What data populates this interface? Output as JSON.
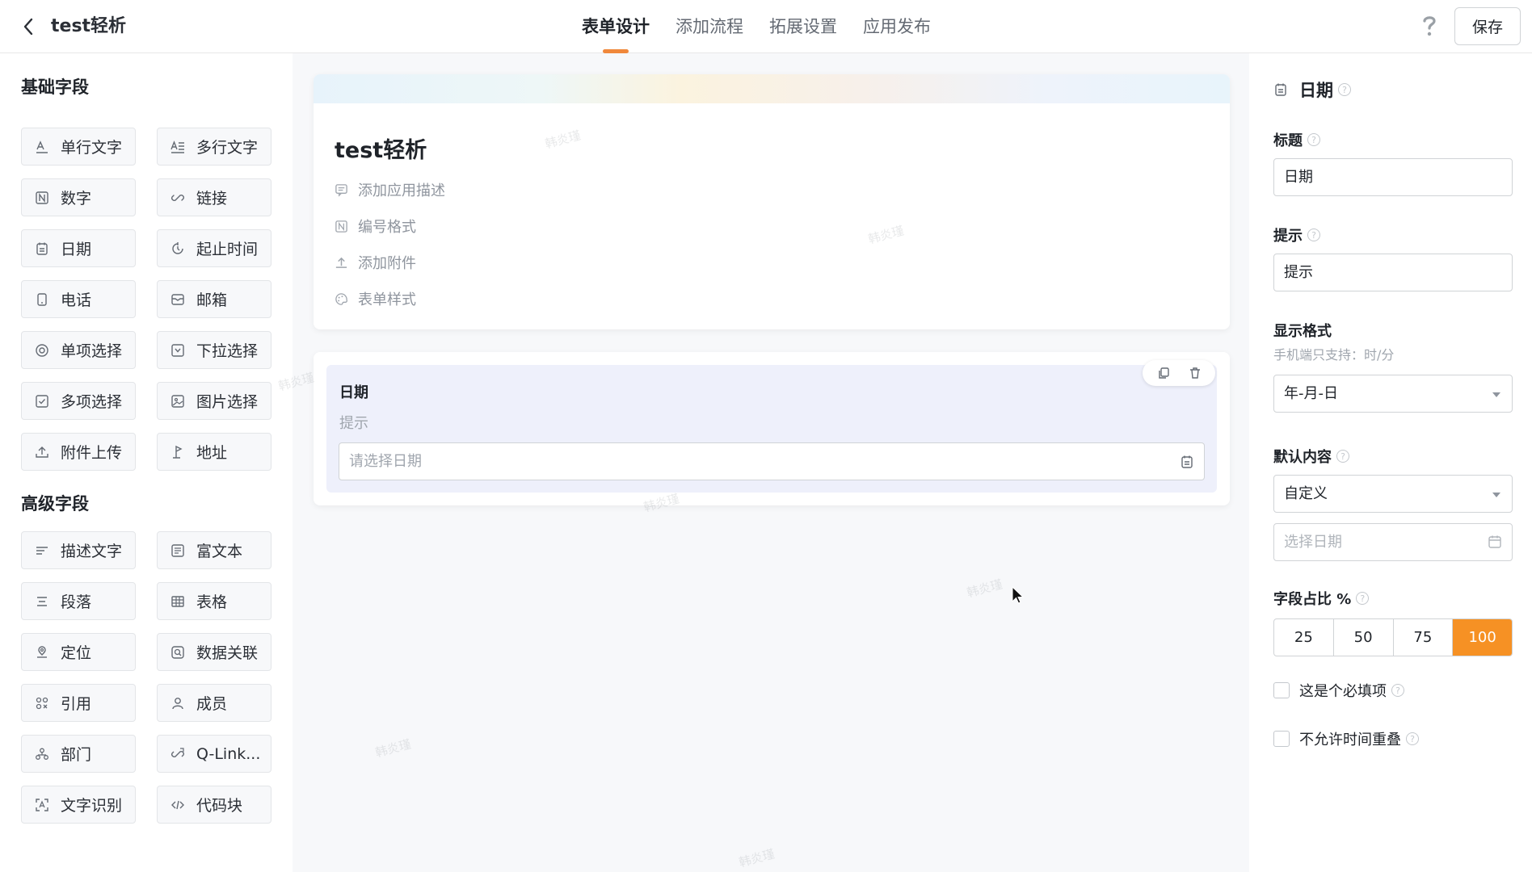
{
  "header": {
    "app_title": "test轻析",
    "tabs": [
      {
        "label": "表单设计",
        "active": true
      },
      {
        "label": "添加流程",
        "active": false
      },
      {
        "label": "拓展设置",
        "active": false
      },
      {
        "label": "应用发布",
        "active": false
      }
    ],
    "help_icon": "question-mark",
    "save_label": "保存"
  },
  "palette": {
    "basic_title": "基础字段",
    "basic_fields": [
      {
        "label": "单行文字",
        "icon": "single-text"
      },
      {
        "label": "多行文字",
        "icon": "multi-text"
      },
      {
        "label": "数字",
        "icon": "number"
      },
      {
        "label": "链接",
        "icon": "link"
      },
      {
        "label": "日期",
        "icon": "calendar"
      },
      {
        "label": "起止时间",
        "icon": "time-range"
      },
      {
        "label": "电话",
        "icon": "phone"
      },
      {
        "label": "邮箱",
        "icon": "mail"
      },
      {
        "label": "单项选择",
        "icon": "radio"
      },
      {
        "label": "下拉选择",
        "icon": "dropdown"
      },
      {
        "label": "多项选择",
        "icon": "checkbox"
      },
      {
        "label": "图片选择",
        "icon": "image"
      },
      {
        "label": "附件上传",
        "icon": "upload"
      },
      {
        "label": "地址",
        "icon": "location-pin"
      }
    ],
    "advanced_title": "高级字段",
    "advanced_fields": [
      {
        "label": "描述文字",
        "icon": "description"
      },
      {
        "label": "富文本",
        "icon": "rich-text"
      },
      {
        "label": "段落",
        "icon": "paragraph"
      },
      {
        "label": "表格",
        "icon": "table"
      },
      {
        "label": "定位",
        "icon": "positioning"
      },
      {
        "label": "数据关联",
        "icon": "data-link"
      },
      {
        "label": "引用",
        "icon": "reference"
      },
      {
        "label": "成员",
        "icon": "member"
      },
      {
        "label": "部门",
        "icon": "department"
      },
      {
        "label": "Q-Link...",
        "icon": "q-link"
      },
      {
        "label": "文字识别",
        "icon": "ocr"
      },
      {
        "label": "代码块",
        "icon": "code"
      }
    ]
  },
  "canvas": {
    "form_title": "test轻析",
    "meta_items": [
      {
        "label": "添加应用描述",
        "icon": "comment"
      },
      {
        "label": "编号格式",
        "icon": "number"
      },
      {
        "label": "添加附件",
        "icon": "upload"
      },
      {
        "label": "表单样式",
        "icon": "palette"
      }
    ],
    "selected_field": {
      "label": "日期",
      "hint": "提示",
      "placeholder": "请选择日期"
    },
    "watermark": "韩炎瑾"
  },
  "properties": {
    "header_title": "日期",
    "title_label": "标题",
    "title_value": "日期",
    "hint_label": "提示",
    "hint_value": "提示",
    "format_label": "显示格式",
    "format_sub": "手机端只支持：时/分",
    "format_value": "年-月-日",
    "default_label": "默认内容",
    "default_value": "自定义",
    "date_placeholder": "选择日期",
    "ratio_label": "字段占比 %",
    "ratio_options": [
      "25",
      "50",
      "75",
      "100"
    ],
    "ratio_selected": "100",
    "required_label": "这是个必填项",
    "no_overlap_label": "不允许时间重叠"
  },
  "colors": {
    "accent": "#f69124",
    "tab_underline": "#f0883b",
    "selected_bg": "#eef0fb"
  }
}
